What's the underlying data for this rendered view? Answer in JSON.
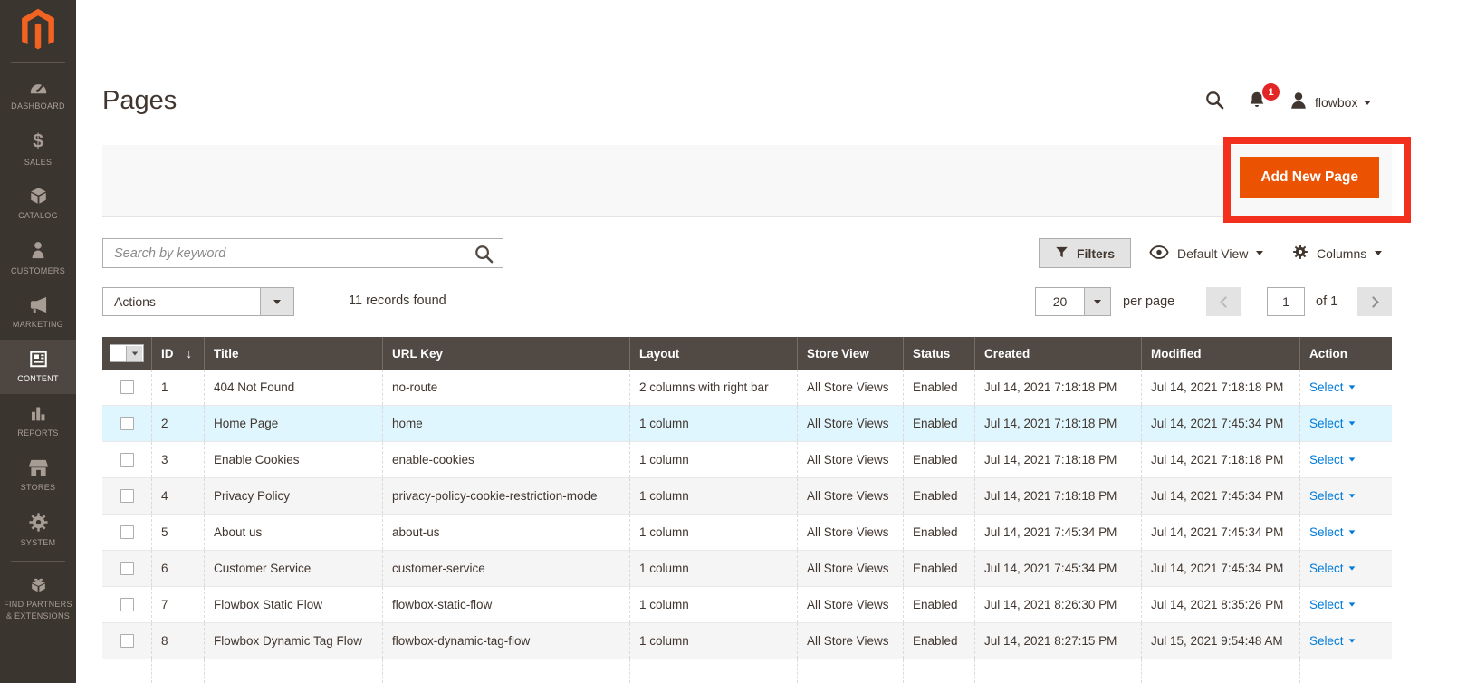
{
  "colors": {
    "brand_orange": "#eb5202",
    "link_blue": "#007bdb",
    "badge_red": "#e22626",
    "annotation_red": "#f3301d",
    "grid_header_bg": "#514943",
    "row_highlight": "#e0f6fe"
  },
  "sidebar": {
    "logo_icon": "magento-logo",
    "items": [
      {
        "label": "DASHBOARD",
        "icon": "dashboard-gauge-icon",
        "selected": false
      },
      {
        "label": "SALES",
        "icon": "dollar-icon",
        "selected": false
      },
      {
        "label": "CATALOG",
        "icon": "box-icon",
        "selected": false
      },
      {
        "label": "CUSTOMERS",
        "icon": "person-icon",
        "selected": false
      },
      {
        "label": "MARKETING",
        "icon": "megaphone-icon",
        "selected": false
      },
      {
        "label": "CONTENT",
        "icon": "layout-icon",
        "selected": true
      },
      {
        "label": "REPORTS",
        "icon": "bar-chart-icon",
        "selected": false
      },
      {
        "label": "STORES",
        "icon": "storefront-icon",
        "selected": false
      },
      {
        "label": "SYSTEM",
        "icon": "gear-icon",
        "selected": false
      },
      {
        "label": "FIND PARTNERS & EXTENSIONS",
        "icon": "extensions-icon",
        "selected": false
      }
    ]
  },
  "header": {
    "page_title": "Pages",
    "notification_count": "1",
    "username": "flowbox"
  },
  "toolbar": {
    "add_new_page_label": "Add New Page"
  },
  "grid_controls": {
    "search_placeholder": "Search by keyword",
    "filters_label": "Filters",
    "view_label": "Default View",
    "columns_label": "Columns"
  },
  "actions_bar": {
    "actions_label": "Actions",
    "records_found": "11 records found",
    "per_page_value": "20",
    "per_page_label": "per page",
    "current_page": "1",
    "page_count_label": "of 1"
  },
  "table": {
    "columns": [
      "ID",
      "Title",
      "URL Key",
      "Layout",
      "Store View",
      "Status",
      "Created",
      "Modified",
      "Action"
    ],
    "select_label": "Select",
    "rows": [
      {
        "id": "1",
        "title": "404 Not Found",
        "url_key": "no-route",
        "layout": "2 columns with right bar",
        "store_view": "All Store Views",
        "status": "Enabled",
        "created": "Jul 14, 2021 7:18:18 PM",
        "modified": "Jul 14, 2021 7:18:18 PM",
        "highlighted": false
      },
      {
        "id": "2",
        "title": "Home Page",
        "url_key": "home",
        "layout": "1 column",
        "store_view": "All Store Views",
        "status": "Enabled",
        "created": "Jul 14, 2021 7:18:18 PM",
        "modified": "Jul 14, 2021 7:45:34 PM",
        "highlighted": true
      },
      {
        "id": "3",
        "title": "Enable Cookies",
        "url_key": "enable-cookies",
        "layout": "1 column",
        "store_view": "All Store Views",
        "status": "Enabled",
        "created": "Jul 14, 2021 7:18:18 PM",
        "modified": "Jul 14, 2021 7:18:18 PM",
        "highlighted": false
      },
      {
        "id": "4",
        "title": "Privacy Policy",
        "url_key": "privacy-policy-cookie-restriction-mode",
        "layout": "1 column",
        "store_view": "All Store Views",
        "status": "Enabled",
        "created": "Jul 14, 2021 7:18:18 PM",
        "modified": "Jul 14, 2021 7:45:34 PM",
        "highlighted": false
      },
      {
        "id": "5",
        "title": "About us",
        "url_key": "about-us",
        "layout": "1 column",
        "store_view": "All Store Views",
        "status": "Enabled",
        "created": "Jul 14, 2021 7:45:34 PM",
        "modified": "Jul 14, 2021 7:45:34 PM",
        "highlighted": false
      },
      {
        "id": "6",
        "title": "Customer Service",
        "url_key": "customer-service",
        "layout": "1 column",
        "store_view": "All Store Views",
        "status": "Enabled",
        "created": "Jul 14, 2021 7:45:34 PM",
        "modified": "Jul 14, 2021 7:45:34 PM",
        "highlighted": false
      },
      {
        "id": "7",
        "title": "Flowbox Static Flow",
        "url_key": "flowbox-static-flow",
        "layout": "1 column",
        "store_view": "All Store Views",
        "status": "Enabled",
        "created": "Jul 14, 2021 8:26:30 PM",
        "modified": "Jul 14, 2021 8:35:26 PM",
        "highlighted": false
      },
      {
        "id": "8",
        "title": "Flowbox Dynamic Tag Flow",
        "url_key": "flowbox-dynamic-tag-flow",
        "layout": "1 column",
        "store_view": "All Store Views",
        "status": "Enabled",
        "created": "Jul 14, 2021 8:27:15 PM",
        "modified": "Jul 15, 2021 9:54:48 AM",
        "highlighted": false
      }
    ]
  }
}
